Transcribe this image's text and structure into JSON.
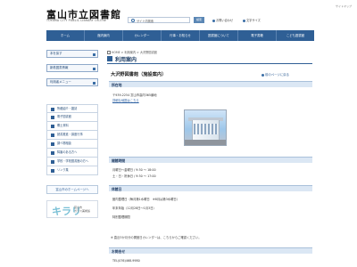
{
  "header": {
    "title": "富山市立図書館",
    "subtitle": "TOYAMA CITY PUBLIC LIBRARY On-line",
    "sitemap": "サイトマップ",
    "search_label": "サイト内検索",
    "search_button": "検索",
    "links": [
      "お問い合わせ",
      "文字サイズ"
    ],
    "search_value": ""
  },
  "nav": {
    "items": [
      "ホーム",
      "館内案内",
      "カレンダー",
      "行事・お知らせ",
      "図書館について",
      "電子書籍",
      "こども図書館"
    ]
  },
  "sidebar": {
    "buttons": [
      "本を探す",
      "新着図書情報",
      "利用者メニュー"
    ],
    "items": [
      "所蔵紹介・雑誌",
      "電子図書館",
      "郷土資料",
      "読書推進・講座行事",
      "調べ物相談",
      "障害のある方へ",
      "学校・学校図書館の方へ",
      "リンク集"
    ],
    "banner1": "富山市のホームページへ",
    "banner2_logo": "キラリ",
    "banner2_text": [
      "富山市",
      "ガラス美術館"
    ]
  },
  "main": {
    "breadcrumb": "HOME > 利用案内 > 大沢野図書館",
    "page_title": "利用案内",
    "facility_title": "大沢野図書館（施設案内）",
    "back_link": "前のページに戻る",
    "location_section": "所在地",
    "address": "〒939-2254 富山市高内365番地",
    "map_link": "詳細な地図はこちら",
    "hours_section": "開館時間",
    "hours_lines": [
      "月曜日～金曜日 / 9:30 ～ 18:00",
      "土・日・祝休日 / 9:30 ～ 17:00"
    ],
    "closed_section": "休館日",
    "closed_lines": [
      "館内整理日（毎月第1水曜日　※8月は第3水曜日）",
      "年末年始（12月28日～1月3日）",
      "特別整理期間"
    ],
    "notice": "※ 直近3か月分の開館日カレンダーは、こちらからご確認ください。",
    "notice_link": "こちら",
    "contact_section": "お問合せ",
    "tel": "TEL(076)468-9980"
  },
  "colors": {
    "nav_bg": "#2f5f95",
    "section_bg": "#dbe7f4",
    "link": "#2a5ea0"
  }
}
